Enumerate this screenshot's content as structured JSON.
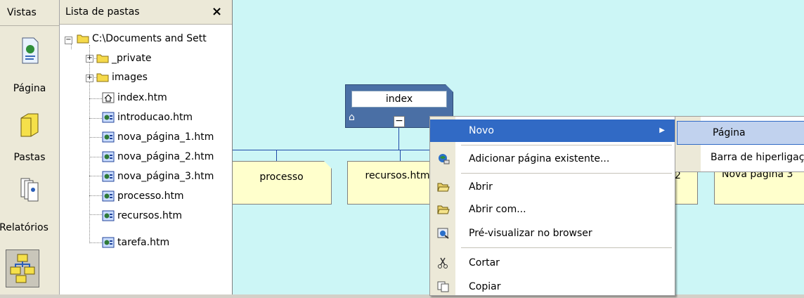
{
  "views": {
    "header": "Vistas",
    "items": [
      {
        "label": "Página",
        "icon": "page-icon"
      },
      {
        "label": "Pastas",
        "icon": "folder-icon"
      },
      {
        "label": "Relatórios",
        "icon": "reports-icon"
      },
      {
        "label": "",
        "icon": "navigation-icon"
      }
    ]
  },
  "folder_list": {
    "title": "Lista de pastas",
    "close": "×",
    "root": "C:\\Documents and Sett",
    "folders": [
      "_private",
      "images"
    ],
    "files": [
      "index.htm",
      "introducao.htm",
      "nova_página_1.htm",
      "nova_página_2.htm",
      "nova_página_3.htm",
      "processo.htm",
      "recursos.htm",
      "tarefa.htm"
    ]
  },
  "navigation": {
    "root_label": "index",
    "children": [
      "processo",
      "recursos.htm",
      "2",
      "Nova página 3"
    ]
  },
  "context_menu": {
    "items": [
      {
        "label": "Novo",
        "icon": "",
        "submenu": true
      },
      {
        "label": "Adicionar página existente...",
        "icon": "add-page-icon"
      },
      {
        "label": "Abrir",
        "icon": "open-folder-icon"
      },
      {
        "label": "Abrir com...",
        "icon": "open-with-icon"
      },
      {
        "label": "Pré-visualizar no browser",
        "icon": "preview-icon"
      },
      {
        "label": "Cortar",
        "icon": "cut-icon"
      },
      {
        "label": "Copiar",
        "icon": "copy-icon"
      }
    ]
  },
  "submenu": {
    "items": [
      "Página",
      "Barra de hiperligações"
    ]
  },
  "colors": {
    "canvas": "#ccf6f6",
    "highlight": "#316ac5",
    "node_fill": "#ffffcc",
    "root_fill": "#4a6fa5"
  }
}
